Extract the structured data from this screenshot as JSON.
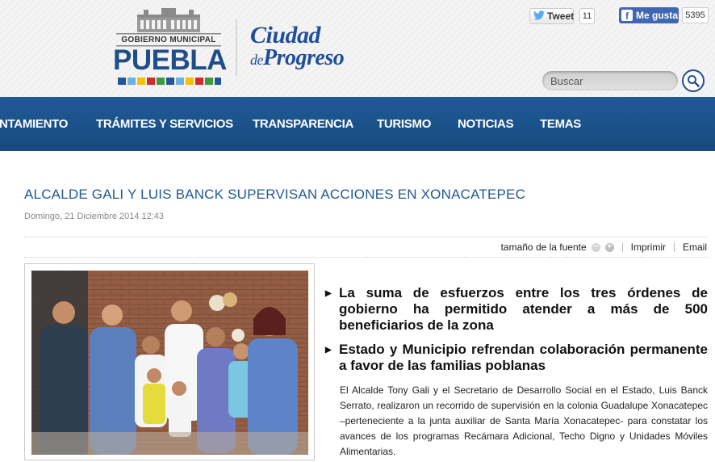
{
  "header": {
    "logo": {
      "small_text": "GOBIERNO MUNICIPAL",
      "main_text": "PUEBLA"
    },
    "tagline": {
      "line1": "Ciudad",
      "de": "de",
      "line2": "Progreso"
    },
    "social": {
      "tweet_label": "Tweet",
      "tweet_count": "11",
      "fb_label": "Me gusta",
      "fb_count": "5395"
    },
    "search": {
      "placeholder": "Buscar"
    }
  },
  "nav": {
    "items": [
      "NTAMIENTO",
      "TRÁMITES Y SERVICIOS",
      "TRANSPARENCIA",
      "TURISMO",
      "NOTICIAS",
      "TEMAS"
    ]
  },
  "article": {
    "title": "ALCALDE GALI Y LUIS BANCK SUPERVISAN ACCIONES EN XONACATEPEC",
    "date": "Domingo, 21 Diciembre 2014 12:43",
    "toolbar": {
      "font_size_label": "tamaño de la fuente",
      "print_label": "Imprimir",
      "email_label": "Email"
    },
    "bullets": [
      "La suma de esfuerzos entre los tres órdenes de gobierno ha permitido atender a más de 500 beneficiarios de la zona",
      "Estado y Municipio refrendan colaboración permanente a favor de las familias poblanas"
    ],
    "body": "El Alcalde Tony Gali y el Secretario de Desarrollo Social en el Estado, Luis Banck Serrato, realizaron un recorrido de supervisión en la colonia Guadalupe Xonacatepec –perteneciente a la junta auxiliar de Santa María Xonacatepec- para constatar  los avances de los programas Recámara Adicional, Techo Digno y Unidades Móviles Alimentarias."
  },
  "colors": {
    "nav_blue": "#1f5a96",
    "title_blue": "#1f5a96",
    "facebook_blue": "#4267b2"
  }
}
